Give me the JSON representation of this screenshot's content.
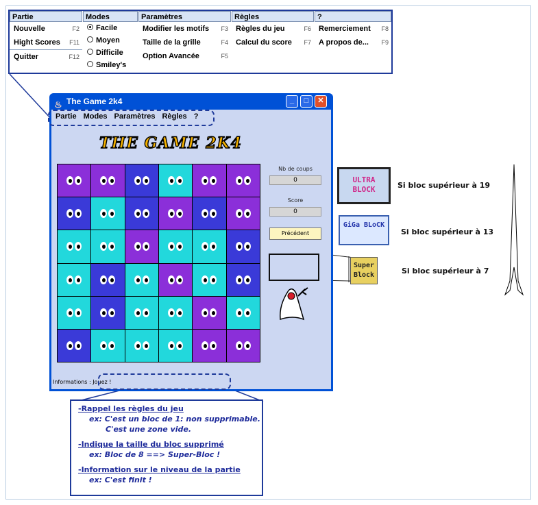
{
  "top_menu": {
    "columns": [
      {
        "title": "Partie",
        "items": [
          {
            "label": "Nouvelle",
            "key": "F2"
          },
          {
            "label": "Hight Scores",
            "key": "F11"
          },
          {
            "label": "Quitter",
            "key": "F12"
          }
        ]
      },
      {
        "title": "Modes",
        "items": [
          {
            "label": "Facile",
            "selected": true
          },
          {
            "label": "Moyen",
            "selected": false
          },
          {
            "label": "Difficile",
            "selected": false
          },
          {
            "label": "Smiley's",
            "selected": false
          }
        ]
      },
      {
        "title": "Paramètres",
        "items": [
          {
            "label": "Modifier les motifs",
            "key": "F3"
          },
          {
            "label": "Taille de la grille",
            "key": "F4"
          },
          {
            "label": "Option Avancée",
            "key": "F5"
          }
        ]
      },
      {
        "title": "Règles",
        "items": [
          {
            "label": "Règles du jeu",
            "key": "F6"
          },
          {
            "label": "Calcul du score",
            "key": "F7"
          }
        ]
      },
      {
        "title": "?",
        "items": [
          {
            "label": "Remerciement",
            "key": "F8"
          },
          {
            "label": "A propos de...",
            "key": "F9"
          }
        ]
      }
    ]
  },
  "window": {
    "title": "The Game 2k4",
    "menubar": [
      "Partie",
      "Modes",
      "Paramètres",
      "Règles",
      "?"
    ],
    "logo": "THE GAME 2K4",
    "grid": [
      [
        "purple",
        "purple",
        "blue",
        "cyan",
        "purple",
        "purple"
      ],
      [
        "blue",
        "cyan",
        "blue",
        "purple",
        "blue",
        "purple"
      ],
      [
        "cyan",
        "cyan",
        "purple",
        "cyan",
        "cyan",
        "blue"
      ],
      [
        "cyan",
        "blue",
        "cyan",
        "purple",
        "cyan",
        "blue"
      ],
      [
        "cyan",
        "blue",
        "cyan",
        "cyan",
        "purple",
        "cyan"
      ],
      [
        "blue",
        "cyan",
        "cyan",
        "cyan",
        "purple",
        "purple"
      ]
    ],
    "colors": {
      "purple": "#8b2fd9",
      "blue": "#3a3ad8",
      "cyan": "#22d8dc"
    },
    "coups_label": "Nb de coups",
    "coups_value": "0",
    "score_label": "Score",
    "score_value": "0",
    "prev_button": "Précédent",
    "info_label": "Informations :",
    "info_value": "Jouez !"
  },
  "blocks": {
    "ultra_text": "ULTRA BLOCK",
    "ultra_caption": "Si bloc supérieur à 19",
    "giga_text": "GiGa BLoCK",
    "giga_caption": "Si bloc supérieur à 13",
    "super_text": "Super Block",
    "super_caption": "Si bloc supérieur à 7"
  },
  "note": {
    "l1": "-Rappel les règles du jeu",
    "l2": "ex: C'est un bloc de 1: non supprimable.",
    "l3": "C'est une zone vide.",
    "l4": "-Indique la taille du bloc supprimé",
    "l5": "ex: Bloc de 8 ==> Super-Bloc !",
    "l6": "-Information sur le niveau de la partie",
    "l7": "ex: C'est finit !"
  }
}
